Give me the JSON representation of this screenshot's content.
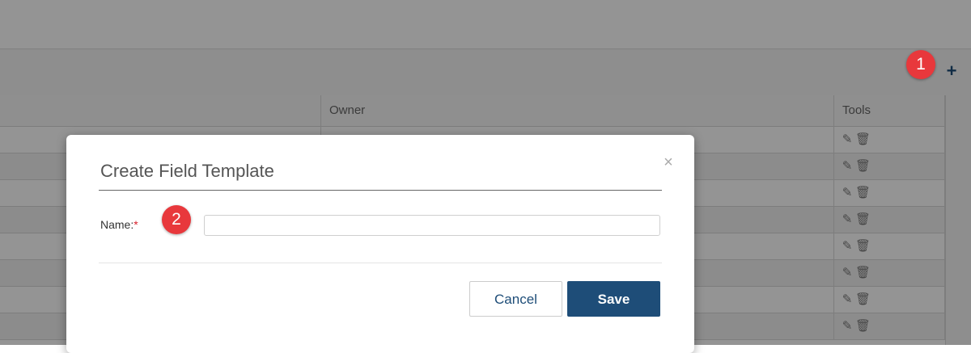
{
  "grid": {
    "columns": {
      "owner": "Owner",
      "tools": "Tools"
    },
    "row_count": 8,
    "icons": {
      "add": "plus-icon",
      "edit": "pencil-icon",
      "delete": "trash-icon"
    }
  },
  "annotations": {
    "badge_1": "1",
    "badge_2": "2"
  },
  "modal": {
    "title": "Create Field Template",
    "close_glyph": "×",
    "name_label": "Name:",
    "required_mark": "*",
    "name_value": "",
    "cancel_label": "Cancel",
    "save_label": "Save"
  },
  "colors": {
    "accent": "#1e4d78",
    "badge": "#e8383c",
    "required": "#d9232d"
  }
}
